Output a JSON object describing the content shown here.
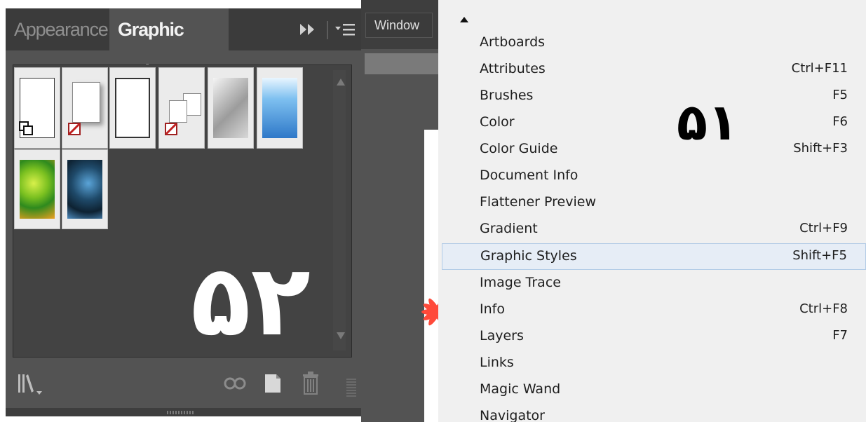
{
  "panel": {
    "tabs": [
      {
        "label": "Appearance",
        "active": false
      },
      {
        "label": "Graphic Styles",
        "active": true
      }
    ],
    "overlay_number": "۵۲",
    "swatch_icons": [
      "default-style",
      "no-stroke-shadow",
      "plain-white",
      "no-fill-offset",
      "gray-gradient",
      "blue-gradient",
      "green-pattern",
      "blue-swirl-pattern"
    ]
  },
  "app_menu": {
    "window_label": "Window"
  },
  "menu": {
    "overlay_number": "۵۱",
    "items": [
      {
        "label": "Artboards",
        "shortcut": ""
      },
      {
        "label": "Attributes",
        "shortcut": "Ctrl+F11"
      },
      {
        "label": "Brushes",
        "shortcut": "F5"
      },
      {
        "label": "Color",
        "shortcut": "F6"
      },
      {
        "label": "Color Guide",
        "shortcut": "Shift+F3"
      },
      {
        "label": "Document Info",
        "shortcut": ""
      },
      {
        "label": "Flattener Preview",
        "shortcut": ""
      },
      {
        "label": "Gradient",
        "shortcut": "Ctrl+F9"
      },
      {
        "label": "Graphic Styles",
        "shortcut": "Shift+F5",
        "highlighted": true
      },
      {
        "label": "Image Trace",
        "shortcut": ""
      },
      {
        "label": "Info",
        "shortcut": "Ctrl+F8"
      },
      {
        "label": "Layers",
        "shortcut": "F7"
      },
      {
        "label": "Links",
        "shortcut": ""
      },
      {
        "label": "Magic Wand",
        "shortcut": ""
      },
      {
        "label": "Navigator",
        "shortcut": ""
      }
    ]
  },
  "colors": {
    "panel_bg": "#535353",
    "tab_bar_bg": "#3b3b3b",
    "menu_bg": "#f0f0f0",
    "menu_highlight": "#e6edf6"
  }
}
